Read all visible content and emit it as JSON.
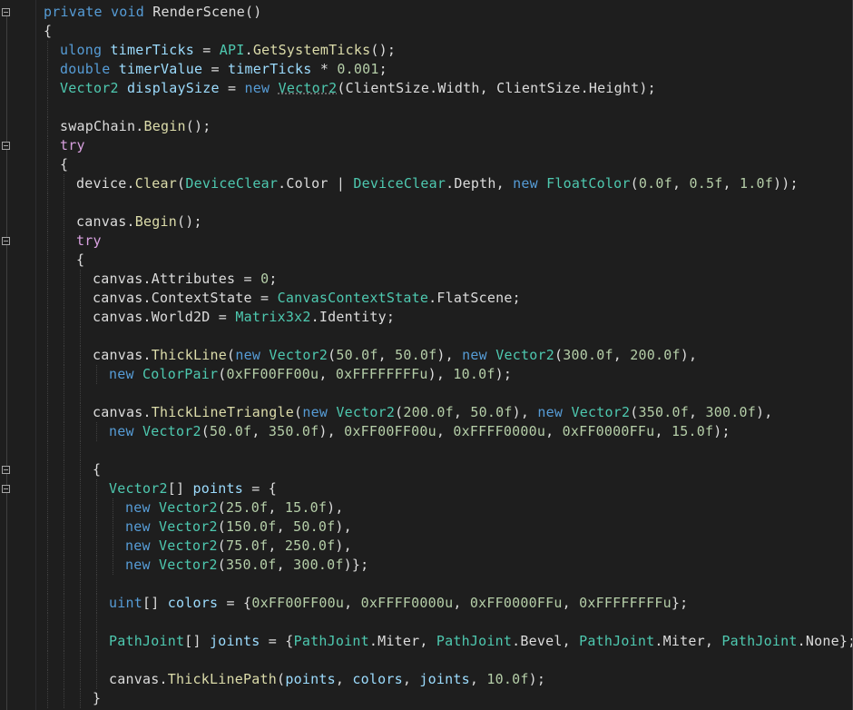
{
  "editor": {
    "colors": {
      "background": "#1e1e1e",
      "keyword": "#569cd6",
      "type": "#4ec9b0",
      "variable": "#9cdcfe",
      "number": "#b5cea8",
      "method": "#dcdcaa",
      "control": "#d8a0df",
      "plain": "#dcdcdc"
    },
    "lines": [
      {
        "indent": 0,
        "fold": true,
        "tokens": [
          {
            "t": "private ",
            "c": "kw"
          },
          {
            "t": "void ",
            "c": "kw"
          },
          {
            "t": "RenderScene",
            "c": "op"
          },
          {
            "t": "()",
            "c": "op"
          }
        ]
      },
      {
        "indent": 0,
        "tokens": [
          {
            "t": "{",
            "c": "op"
          }
        ]
      },
      {
        "indent": 1,
        "tokens": [
          {
            "t": "ulong ",
            "c": "kw"
          },
          {
            "t": "timerTicks",
            "c": "var"
          },
          {
            "t": " = ",
            "c": "op"
          },
          {
            "t": "API",
            "c": "ty"
          },
          {
            "t": ".",
            "c": "op"
          },
          {
            "t": "GetSystemTicks",
            "c": "mth"
          },
          {
            "t": "();",
            "c": "op"
          }
        ]
      },
      {
        "indent": 1,
        "tokens": [
          {
            "t": "double ",
            "c": "kw"
          },
          {
            "t": "timerValue",
            "c": "var"
          },
          {
            "t": " = ",
            "c": "op"
          },
          {
            "t": "timerTicks",
            "c": "var"
          },
          {
            "t": " * ",
            "c": "op"
          },
          {
            "t": "0.001",
            "c": "num"
          },
          {
            "t": ";",
            "c": "op"
          }
        ]
      },
      {
        "indent": 1,
        "tokens": [
          {
            "t": "Vector2 ",
            "c": "ty"
          },
          {
            "t": "displaySize",
            "c": "var"
          },
          {
            "t": " = ",
            "c": "op"
          },
          {
            "t": "new ",
            "c": "kw"
          },
          {
            "t": "Vector2",
            "c": "ty",
            "squig": true
          },
          {
            "t": "(ClientSize.Width, ClientSize.Height);",
            "c": "op"
          }
        ]
      },
      {
        "indent": 1,
        "tokens": []
      },
      {
        "indent": 1,
        "tokens": [
          {
            "t": "swapChain",
            "c": "op"
          },
          {
            "t": ".",
            "c": "op"
          },
          {
            "t": "Begin",
            "c": "mth"
          },
          {
            "t": "();",
            "c": "op"
          }
        ]
      },
      {
        "indent": 1,
        "fold": true,
        "tokens": [
          {
            "t": "try",
            "c": "ctl"
          }
        ]
      },
      {
        "indent": 1,
        "tokens": [
          {
            "t": "{",
            "c": "op"
          }
        ]
      },
      {
        "indent": 2,
        "tokens": [
          {
            "t": "device",
            "c": "op"
          },
          {
            "t": ".",
            "c": "op"
          },
          {
            "t": "Clear",
            "c": "mth"
          },
          {
            "t": "(",
            "c": "op"
          },
          {
            "t": "DeviceClear",
            "c": "ty"
          },
          {
            "t": ".Color | ",
            "c": "op"
          },
          {
            "t": "DeviceClear",
            "c": "ty"
          },
          {
            "t": ".Depth, ",
            "c": "op"
          },
          {
            "t": "new ",
            "c": "kw"
          },
          {
            "t": "FloatColor",
            "c": "ty"
          },
          {
            "t": "(",
            "c": "op"
          },
          {
            "t": "0.0f",
            "c": "num"
          },
          {
            "t": ", ",
            "c": "op"
          },
          {
            "t": "0.5f",
            "c": "num"
          },
          {
            "t": ", ",
            "c": "op"
          },
          {
            "t": "1.0f",
            "c": "num"
          },
          {
            "t": "));",
            "c": "op"
          }
        ]
      },
      {
        "indent": 2,
        "tokens": []
      },
      {
        "indent": 2,
        "tokens": [
          {
            "t": "canvas",
            "c": "op"
          },
          {
            "t": ".",
            "c": "op"
          },
          {
            "t": "Begin",
            "c": "mth"
          },
          {
            "t": "();",
            "c": "op"
          }
        ]
      },
      {
        "indent": 2,
        "fold": true,
        "tokens": [
          {
            "t": "try",
            "c": "ctl"
          }
        ]
      },
      {
        "indent": 2,
        "tokens": [
          {
            "t": "{",
            "c": "op"
          }
        ]
      },
      {
        "indent": 3,
        "tokens": [
          {
            "t": "canvas",
            "c": "op"
          },
          {
            "t": ".",
            "c": "op"
          },
          {
            "t": "Attributes",
            "c": "op"
          },
          {
            "t": " = ",
            "c": "op"
          },
          {
            "t": "0",
            "c": "num"
          },
          {
            "t": ";",
            "c": "op"
          }
        ]
      },
      {
        "indent": 3,
        "tokens": [
          {
            "t": "canvas",
            "c": "op"
          },
          {
            "t": ".",
            "c": "op"
          },
          {
            "t": "ContextState",
            "c": "op"
          },
          {
            "t": " = ",
            "c": "op"
          },
          {
            "t": "CanvasContextState",
            "c": "ty"
          },
          {
            "t": ".FlatScene;",
            "c": "op"
          }
        ]
      },
      {
        "indent": 3,
        "tokens": [
          {
            "t": "canvas",
            "c": "op"
          },
          {
            "t": ".",
            "c": "op"
          },
          {
            "t": "World2D",
            "c": "op"
          },
          {
            "t": " = ",
            "c": "op"
          },
          {
            "t": "Matrix3x2",
            "c": "ty"
          },
          {
            "t": ".Identity;",
            "c": "op"
          }
        ]
      },
      {
        "indent": 3,
        "tokens": []
      },
      {
        "indent": 3,
        "tokens": [
          {
            "t": "canvas",
            "c": "op"
          },
          {
            "t": ".",
            "c": "op"
          },
          {
            "t": "ThickLine",
            "c": "mth"
          },
          {
            "t": "(",
            "c": "op"
          },
          {
            "t": "new ",
            "c": "kw"
          },
          {
            "t": "Vector2",
            "c": "ty"
          },
          {
            "t": "(",
            "c": "op"
          },
          {
            "t": "50.0f",
            "c": "num"
          },
          {
            "t": ", ",
            "c": "op"
          },
          {
            "t": "50.0f",
            "c": "num"
          },
          {
            "t": "), ",
            "c": "op"
          },
          {
            "t": "new ",
            "c": "kw"
          },
          {
            "t": "Vector2",
            "c": "ty"
          },
          {
            "t": "(",
            "c": "op"
          },
          {
            "t": "300.0f",
            "c": "num"
          },
          {
            "t": ", ",
            "c": "op"
          },
          {
            "t": "200.0f",
            "c": "num"
          },
          {
            "t": "),",
            "c": "op"
          }
        ]
      },
      {
        "indent": 4,
        "tokens": [
          {
            "t": "new ",
            "c": "kw"
          },
          {
            "t": "ColorPair",
            "c": "ty"
          },
          {
            "t": "(",
            "c": "op"
          },
          {
            "t": "0xFF00FF00u",
            "c": "num"
          },
          {
            "t": ", ",
            "c": "op"
          },
          {
            "t": "0xFFFFFFFFu",
            "c": "num"
          },
          {
            "t": "), ",
            "c": "op"
          },
          {
            "t": "10.0f",
            "c": "num"
          },
          {
            "t": ");",
            "c": "op"
          }
        ]
      },
      {
        "indent": 3,
        "tokens": []
      },
      {
        "indent": 3,
        "tokens": [
          {
            "t": "canvas",
            "c": "op"
          },
          {
            "t": ".",
            "c": "op"
          },
          {
            "t": "ThickLineTriangle",
            "c": "mth"
          },
          {
            "t": "(",
            "c": "op"
          },
          {
            "t": "new ",
            "c": "kw"
          },
          {
            "t": "Vector2",
            "c": "ty"
          },
          {
            "t": "(",
            "c": "op"
          },
          {
            "t": "200.0f",
            "c": "num"
          },
          {
            "t": ", ",
            "c": "op"
          },
          {
            "t": "50.0f",
            "c": "num"
          },
          {
            "t": "), ",
            "c": "op"
          },
          {
            "t": "new ",
            "c": "kw"
          },
          {
            "t": "Vector2",
            "c": "ty"
          },
          {
            "t": "(",
            "c": "op"
          },
          {
            "t": "350.0f",
            "c": "num"
          },
          {
            "t": ", ",
            "c": "op"
          },
          {
            "t": "300.0f",
            "c": "num"
          },
          {
            "t": "),",
            "c": "op"
          }
        ]
      },
      {
        "indent": 4,
        "tokens": [
          {
            "t": "new ",
            "c": "kw"
          },
          {
            "t": "Vector2",
            "c": "ty"
          },
          {
            "t": "(",
            "c": "op"
          },
          {
            "t": "50.0f",
            "c": "num"
          },
          {
            "t": ", ",
            "c": "op"
          },
          {
            "t": "350.0f",
            "c": "num"
          },
          {
            "t": "), ",
            "c": "op"
          },
          {
            "t": "0xFF00FF00u",
            "c": "num"
          },
          {
            "t": ", ",
            "c": "op"
          },
          {
            "t": "0xFFFF0000u",
            "c": "num"
          },
          {
            "t": ", ",
            "c": "op"
          },
          {
            "t": "0xFF0000FFu",
            "c": "num"
          },
          {
            "t": ", ",
            "c": "op"
          },
          {
            "t": "15.0f",
            "c": "num"
          },
          {
            "t": ");",
            "c": "op"
          }
        ]
      },
      {
        "indent": 3,
        "tokens": []
      },
      {
        "indent": 3,
        "fold": true,
        "tokens": [
          {
            "t": "{",
            "c": "op"
          }
        ]
      },
      {
        "indent": 4,
        "fold": true,
        "tokens": [
          {
            "t": "Vector2",
            "c": "ty"
          },
          {
            "t": "[] ",
            "c": "op"
          },
          {
            "t": "points",
            "c": "var"
          },
          {
            "t": " = {",
            "c": "op"
          }
        ]
      },
      {
        "indent": 5,
        "tokens": [
          {
            "t": "new ",
            "c": "kw"
          },
          {
            "t": "Vector2",
            "c": "ty"
          },
          {
            "t": "(",
            "c": "op"
          },
          {
            "t": "25.0f",
            "c": "num"
          },
          {
            "t": ", ",
            "c": "op"
          },
          {
            "t": "15.0f",
            "c": "num"
          },
          {
            "t": "),",
            "c": "op"
          }
        ]
      },
      {
        "indent": 5,
        "tokens": [
          {
            "t": "new ",
            "c": "kw"
          },
          {
            "t": "Vector2",
            "c": "ty"
          },
          {
            "t": "(",
            "c": "op"
          },
          {
            "t": "150.0f",
            "c": "num"
          },
          {
            "t": ", ",
            "c": "op"
          },
          {
            "t": "50.0f",
            "c": "num"
          },
          {
            "t": "),",
            "c": "op"
          }
        ]
      },
      {
        "indent": 5,
        "tokens": [
          {
            "t": "new ",
            "c": "kw"
          },
          {
            "t": "Vector2",
            "c": "ty"
          },
          {
            "t": "(",
            "c": "op"
          },
          {
            "t": "75.0f",
            "c": "num"
          },
          {
            "t": ", ",
            "c": "op"
          },
          {
            "t": "250.0f",
            "c": "num"
          },
          {
            "t": "),",
            "c": "op"
          }
        ]
      },
      {
        "indent": 5,
        "tokens": [
          {
            "t": "new ",
            "c": "kw"
          },
          {
            "t": "Vector2",
            "c": "ty"
          },
          {
            "t": "(",
            "c": "op"
          },
          {
            "t": "350.0f",
            "c": "num"
          },
          {
            "t": ", ",
            "c": "op"
          },
          {
            "t": "300.0f",
            "c": "num"
          },
          {
            "t": ")};",
            "c": "op"
          }
        ]
      },
      {
        "indent": 4,
        "tokens": []
      },
      {
        "indent": 4,
        "tokens": [
          {
            "t": "uint",
            "c": "kw"
          },
          {
            "t": "[] ",
            "c": "op"
          },
          {
            "t": "colors",
            "c": "var"
          },
          {
            "t": " = {",
            "c": "op"
          },
          {
            "t": "0xFF00FF00u",
            "c": "num"
          },
          {
            "t": ", ",
            "c": "op"
          },
          {
            "t": "0xFFFF0000u",
            "c": "num"
          },
          {
            "t": ", ",
            "c": "op"
          },
          {
            "t": "0xFF0000FFu",
            "c": "num"
          },
          {
            "t": ", ",
            "c": "op"
          },
          {
            "t": "0xFFFFFFFFu",
            "c": "num"
          },
          {
            "t": "};",
            "c": "op"
          }
        ]
      },
      {
        "indent": 4,
        "tokens": []
      },
      {
        "indent": 4,
        "tokens": [
          {
            "t": "PathJoint",
            "c": "ty"
          },
          {
            "t": "[] ",
            "c": "op"
          },
          {
            "t": "joints",
            "c": "var"
          },
          {
            "t": " = {",
            "c": "op"
          },
          {
            "t": "PathJoint",
            "c": "ty"
          },
          {
            "t": ".Miter, ",
            "c": "op"
          },
          {
            "t": "PathJoint",
            "c": "ty"
          },
          {
            "t": ".Bevel, ",
            "c": "op"
          },
          {
            "t": "PathJoint",
            "c": "ty"
          },
          {
            "t": ".Miter, ",
            "c": "op"
          },
          {
            "t": "PathJoint",
            "c": "ty"
          },
          {
            "t": ".None};",
            "c": "op"
          }
        ]
      },
      {
        "indent": 4,
        "tokens": []
      },
      {
        "indent": 4,
        "tokens": [
          {
            "t": "canvas",
            "c": "op"
          },
          {
            "t": ".",
            "c": "op"
          },
          {
            "t": "ThickLinePath",
            "c": "mth"
          },
          {
            "t": "(",
            "c": "op"
          },
          {
            "t": "points",
            "c": "var"
          },
          {
            "t": ", ",
            "c": "op"
          },
          {
            "t": "colors",
            "c": "var"
          },
          {
            "t": ", ",
            "c": "op"
          },
          {
            "t": "joints",
            "c": "var"
          },
          {
            "t": ", ",
            "c": "op"
          },
          {
            "t": "10.0f",
            "c": "num"
          },
          {
            "t": ");",
            "c": "op"
          }
        ]
      },
      {
        "indent": 3,
        "tokens": [
          {
            "t": "}",
            "c": "op"
          }
        ]
      }
    ]
  }
}
